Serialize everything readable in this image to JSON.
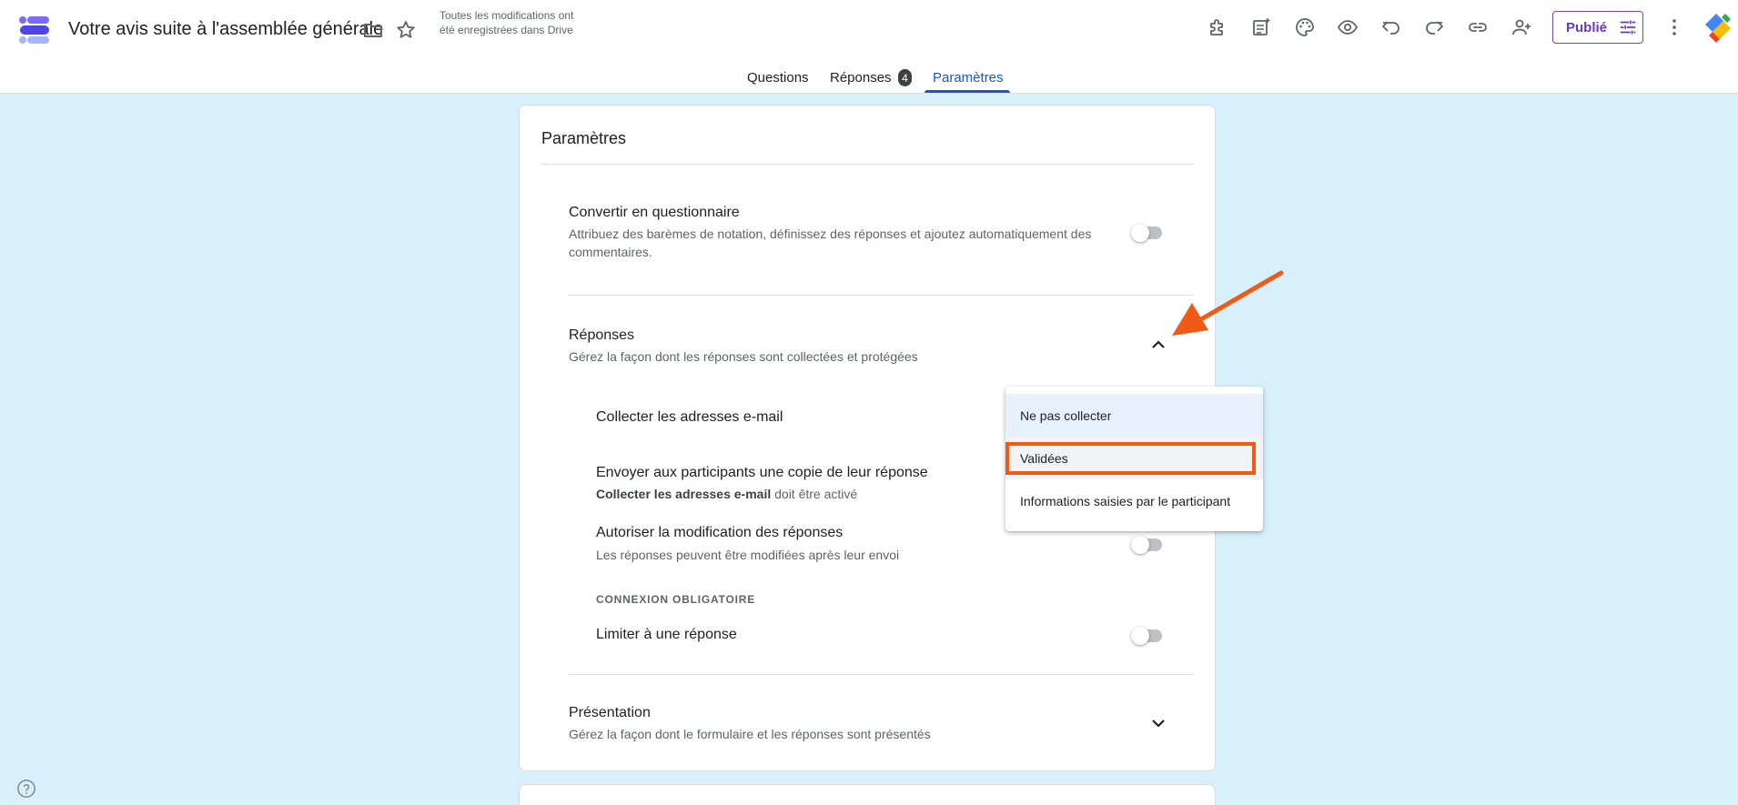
{
  "header": {
    "doc_title": "Votre avis suite à l'assemblée générale",
    "save_status": "Toutes les modifications ont été enregistrées dans Drive",
    "publish_label": "Publié",
    "icons": [
      "forms-logo-icon",
      "folder-icon",
      "star-icon",
      "addon-puzzle-icon",
      "customize-icon",
      "palette-icon",
      "preview-eye-icon",
      "undo-icon",
      "redo-icon",
      "link-icon",
      "add-collaborator-icon",
      "tune-icon",
      "more-vert-icon",
      "account-logo-icon"
    ]
  },
  "tabs": [
    {
      "label": "Questions"
    },
    {
      "label": "Réponses",
      "badge": "4"
    },
    {
      "label": "Paramètres",
      "active": true
    }
  ],
  "settings": {
    "title": "Paramètres",
    "quiz": {
      "title": "Convertir en questionnaire",
      "desc": "Attribuez des barèmes de notation, définissez des réponses et ajoutez automatiquement des commentaires.",
      "enabled": false
    },
    "responses": {
      "title": "Réponses",
      "desc": "Gérez la façon dont les réponses sont collectées et protégées",
      "expanded": true,
      "collect_emails": {
        "title": "Collecter les adresses e-mail"
      },
      "send_copy": {
        "title": "Envoyer aux participants une copie de leur réponse",
        "desc_bold": "Collecter les adresses e-mail",
        "desc_rest": " doit être activé"
      },
      "allow_edit": {
        "title": "Autoriser la modification des réponses",
        "desc": "Les réponses peuvent être modifiées après leur envoi",
        "enabled": false
      },
      "login_required_label": "CONNEXION OBLIGATOIRE",
      "limit_one": {
        "title": "Limiter à une réponse",
        "enabled": false
      }
    },
    "presentation": {
      "title": "Présentation",
      "desc": "Gérez la façon dont le formulaire et les réponses sont présentés",
      "expanded": false
    }
  },
  "dropdown": {
    "options": [
      "Ne pas collecter",
      "Validées",
      "Informations saisies par le participant"
    ],
    "selected": "Ne pas collecter",
    "highlighted": "Validées"
  },
  "colors": {
    "accent": "#673ab7",
    "tab_active": "#1a56c9",
    "background": "#d8f0fb",
    "annotation": "#f05a15"
  }
}
